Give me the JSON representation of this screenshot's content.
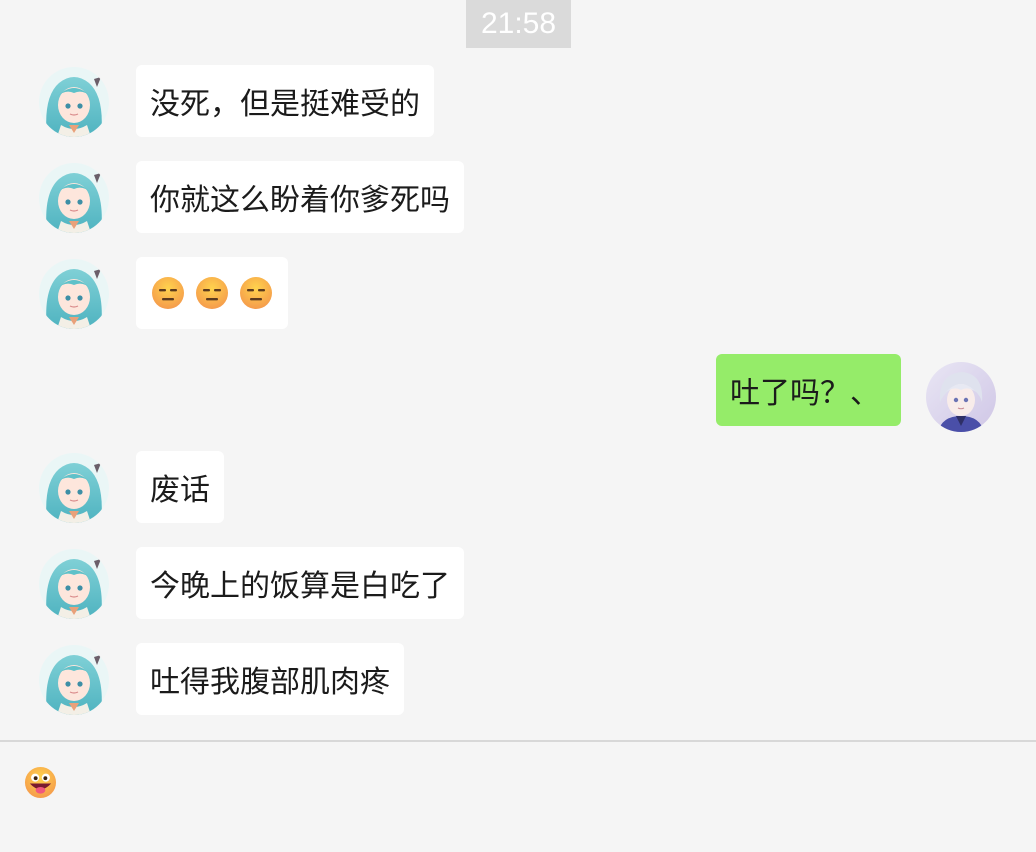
{
  "time": "21:58",
  "messages": [
    {
      "side": "left",
      "text": "没死，但是挺难受的"
    },
    {
      "side": "left",
      "text": "你就这么盼着你爹死吗"
    },
    {
      "side": "left",
      "text": "",
      "emojis": [
        "expressionless-face",
        "expressionless-face",
        "expressionless-face"
      ]
    },
    {
      "side": "right",
      "text": "吐了吗？、"
    },
    {
      "side": "left",
      "text": "废话"
    },
    {
      "side": "left",
      "text": "今晚上的饭算是白吃了"
    },
    {
      "side": "left",
      "text": "吐得我腹部肌肉疼"
    }
  ],
  "input": {
    "emoji_button_icon": "grinning-tongue-face-icon"
  },
  "colors": {
    "background": "#f5f5f5",
    "bubble_left": "#ffffff",
    "bubble_right": "#95ec69",
    "time_badge": "#dadada"
  }
}
